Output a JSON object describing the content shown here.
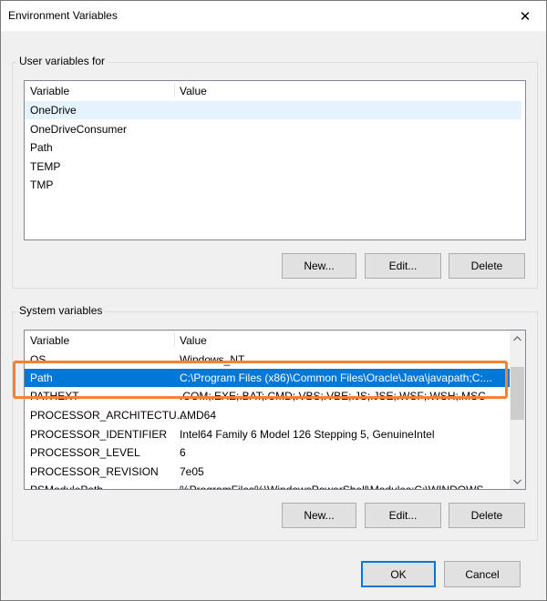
{
  "window": {
    "title": "Environment Variables",
    "close_glyph": "✕"
  },
  "user_vars": {
    "group_label": "User variables for",
    "headers": [
      "Variable",
      "Value"
    ],
    "rows": [
      {
        "name": "OneDrive",
        "value": ""
      },
      {
        "name": "OneDriveConsumer",
        "value": ""
      },
      {
        "name": "Path",
        "value": ""
      },
      {
        "name": "TEMP",
        "value": ""
      },
      {
        "name": "TMP",
        "value": ""
      }
    ],
    "buttons": {
      "new": "New...",
      "edit": "Edit...",
      "delete": "Delete"
    }
  },
  "system_vars": {
    "group_label": "System variables",
    "headers": [
      "Variable",
      "Value"
    ],
    "rows": [
      {
        "name": "OS",
        "value": "Windows_NT"
      },
      {
        "name": "Path",
        "value": "C:\\Program Files (x86)\\Common Files\\Oracle\\Java\\javapath;C:..."
      },
      {
        "name": "PATHEXT",
        "value": ".COM;.EXE;.BAT;.CMD;.VBS;.VBE;.JS;.JSE;.WSF;.WSH;.MSC"
      },
      {
        "name": "PROCESSOR_ARCHITECTU...",
        "value": "AMD64"
      },
      {
        "name": "PROCESSOR_IDENTIFIER",
        "value": "Intel64 Family 6 Model 126 Stepping 5, GenuineIntel"
      },
      {
        "name": "PROCESSOR_LEVEL",
        "value": "6"
      },
      {
        "name": "PROCESSOR_REVISION",
        "value": "7e05"
      },
      {
        "name": "PSModulePath",
        "value": "%ProgramFiles%\\WindowsPowerShell\\Modules;C:\\WINDOWS..."
      }
    ],
    "selected_index": 1,
    "buttons": {
      "new": "New...",
      "edit": "Edit...",
      "delete": "Delete"
    }
  },
  "footer": {
    "ok": "OK",
    "cancel": "Cancel"
  },
  "colors": {
    "selection": "#0078d7",
    "highlight_box": "#f5822e"
  }
}
